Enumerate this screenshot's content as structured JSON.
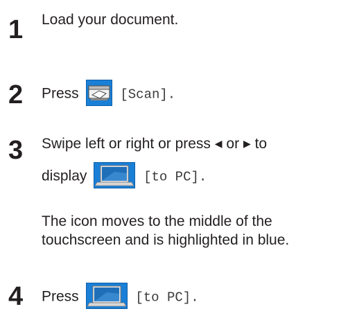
{
  "steps": [
    {
      "number": "1",
      "text": "Load your document."
    },
    {
      "number": "2",
      "prefix": "Press",
      "button_label": "[Scan].",
      "icon": "scanner-icon"
    },
    {
      "number": "3",
      "line1_a": "Swipe left or right or press",
      "left_arrow": "◀",
      "line1_or": "or",
      "right_arrow": "▶",
      "line1_to": "to",
      "line2_prefix": "display",
      "button_label": "[to PC].",
      "icon": "laptop-icon",
      "note_line1": "The icon moves to the middle of the",
      "note_line2": "touchscreen and is highlighted in blue."
    },
    {
      "number": "4",
      "prefix": "Press",
      "button_label": "[to PC].",
      "icon": "laptop-icon"
    }
  ],
  "colors": {
    "icon_blue": "#1a7fd6",
    "icon_frame": "#d0d0d0",
    "text": "#231f20"
  }
}
